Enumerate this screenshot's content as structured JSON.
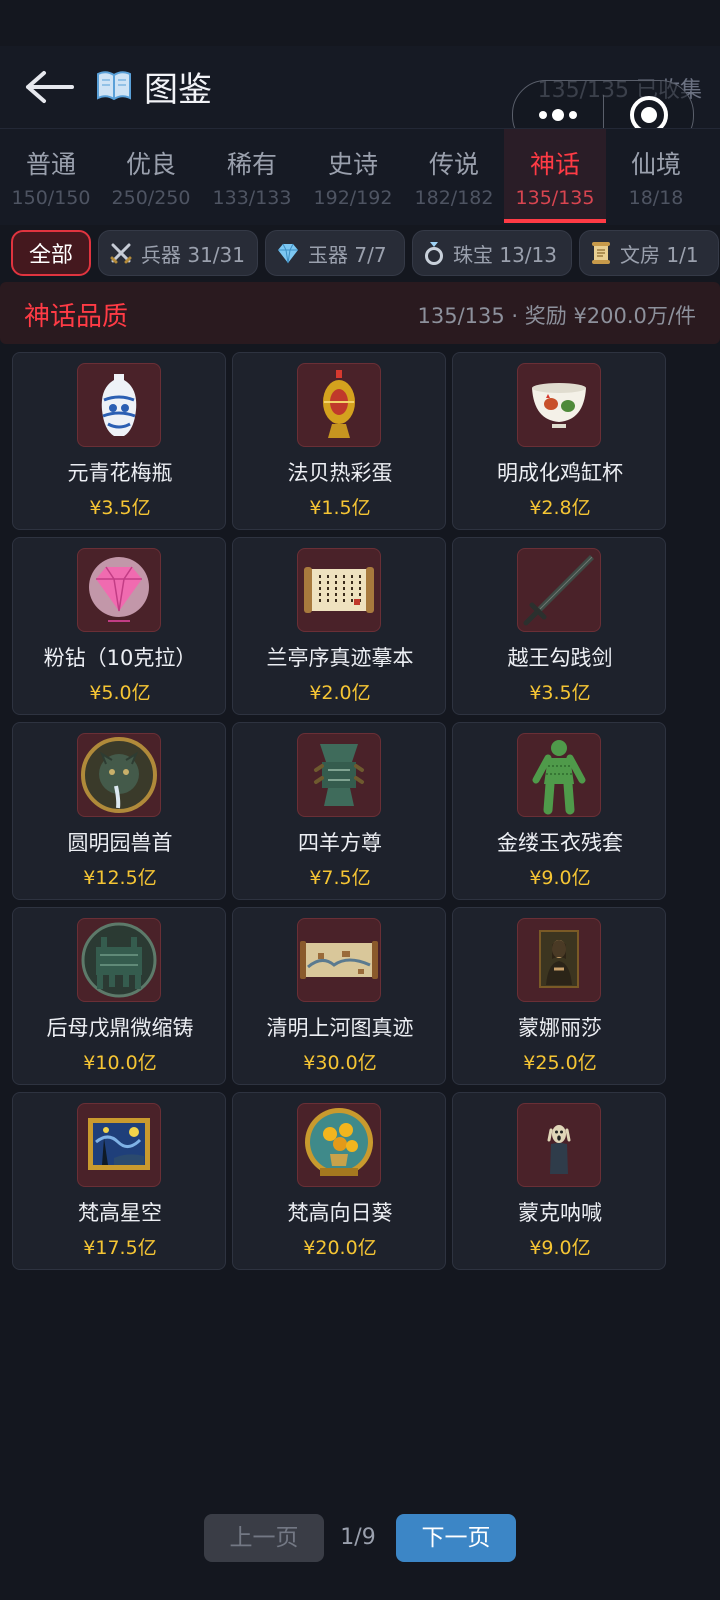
{
  "header": {
    "title": "图鉴",
    "collected_text": "135/135 已收集",
    "back_icon": "arrow-left-icon",
    "title_icon": "open-book-icon"
  },
  "capsule": {
    "more_icon": "more-dots-icon",
    "close_icon": "target-close-icon"
  },
  "tabs": [
    {
      "label": "普通",
      "count": "150/150"
    },
    {
      "label": "优良",
      "count": "250/250"
    },
    {
      "label": "稀有",
      "count": "133/133"
    },
    {
      "label": "史诗",
      "count": "192/192"
    },
    {
      "label": "传说",
      "count": "182/182"
    },
    {
      "label": "神话",
      "count": "135/135",
      "active": true
    },
    {
      "label": "仙境",
      "count": "18/18"
    }
  ],
  "chips": [
    {
      "label": "全部",
      "active": true
    },
    {
      "label": "兵器 31/31",
      "icon": "crossed-swords-icon"
    },
    {
      "label": "玉器 7/7",
      "icon": "diamond-icon"
    },
    {
      "label": "珠宝 13/13",
      "icon": "ring-icon"
    },
    {
      "label": "文房 1/1",
      "icon": "scroll-icon"
    }
  ],
  "banner": {
    "left": "神话品质",
    "right": "135/135 · 奖励 ¥200.0万/件"
  },
  "items": [
    {
      "name": "元青花梅瓶",
      "price": "¥3.5亿",
      "icon": "blue-white-vase-icon"
    },
    {
      "name": "法贝热彩蛋",
      "price": "¥1.5亿",
      "icon": "faberge-egg-icon"
    },
    {
      "name": "明成化鸡缸杯",
      "price": "¥2.8亿",
      "icon": "chicken-cup-icon"
    },
    {
      "name": "粉钻（10克拉）",
      "price": "¥5.0亿",
      "icon": "pink-diamond-icon"
    },
    {
      "name": "兰亭序真迹摹本",
      "price": "¥2.0亿",
      "icon": "calligraphy-scroll-icon"
    },
    {
      "name": "越王勾践剑",
      "price": "¥3.5亿",
      "icon": "bronze-sword-icon"
    },
    {
      "name": "圆明园兽首",
      "price": "¥12.5亿",
      "icon": "bronze-zodiac-head-icon"
    },
    {
      "name": "四羊方尊",
      "price": "¥7.5亿",
      "icon": "bronze-zun-vessel-icon"
    },
    {
      "name": "金缕玉衣残套",
      "price": "¥9.0亿",
      "icon": "jade-burial-suit-icon"
    },
    {
      "name": "后母戊鼎微缩铸",
      "price": "¥10.0亿",
      "icon": "bronze-ding-icon"
    },
    {
      "name": "清明上河图真迹",
      "price": "¥30.0亿",
      "icon": "landscape-scroll-icon"
    },
    {
      "name": "蒙娜丽莎",
      "price": "¥25.0亿",
      "icon": "mona-lisa-icon"
    },
    {
      "name": "梵高星空",
      "price": "¥17.5亿",
      "icon": "starry-night-icon"
    },
    {
      "name": "梵高向日葵",
      "price": "¥20.0亿",
      "icon": "sunflowers-icon"
    },
    {
      "name": "蒙克呐喊",
      "price": "¥9.0亿",
      "icon": "the-scream-icon"
    }
  ],
  "pager": {
    "prev": "上一页",
    "page": "1/9",
    "next": "下一页"
  },
  "colors": {
    "accent": "#ff3b45",
    "price": "#f5c534",
    "next_button": "#3c86c6"
  }
}
